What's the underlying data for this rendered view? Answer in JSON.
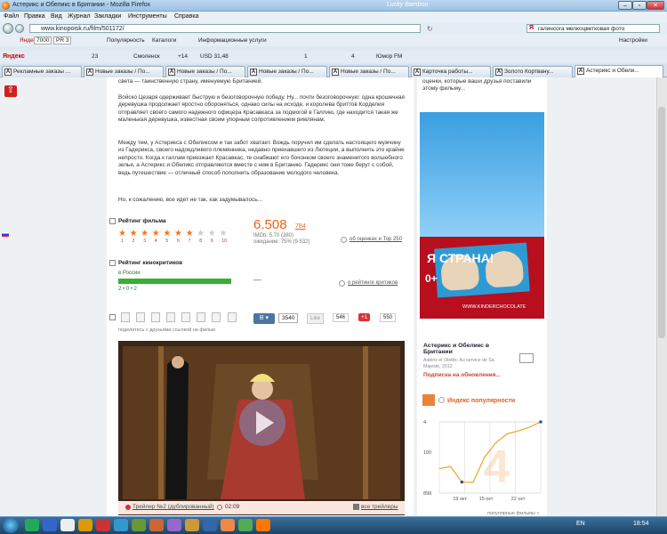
{
  "window": {
    "title": "Астерикс и Обеликс в Британии - Mozilla Firefox",
    "brand": "Lucky Bamboo"
  },
  "menu": [
    "Файл",
    "Правка",
    "Вид",
    "Журнал",
    "Закладки",
    "Инструменты",
    "Справка"
  ],
  "url": "www.kinopoisk.ru/film/501172/",
  "search_value": "галинсога мелкоцветковая фото",
  "toolbar1": {
    "ya": "Яндекс",
    "pr": "PR 3",
    "tic": "7000",
    "popular": "Популярность",
    "catalogs": "Каталоги",
    "info": "Информационные услуги"
  },
  "toolbar2": {
    "mail": "23",
    "weather": "Смоленск",
    "temp": "+14",
    "usd": "USD 31,48",
    "num1": "1",
    "num2": "4",
    "humor": "Юмор FM",
    "settings": "Настройки"
  },
  "tabs": [
    "Рекламные заказы ...",
    "Новые заказы / По...",
    "Новые заказы / По...",
    "Новые заказы / По...",
    "Новые заказы / По...",
    "Карточка работы...",
    "Золото Кортвану...",
    "Астерикс и Обели..."
  ],
  "text": {
    "p0": "света — таинственную страну, именуемую Британией.",
    "p1": "Войско Цезаря одерживает быструю и безоговорочную победу. Ну... почти безоговорочную: одна крошечная деревушка продолжает яростно обороняться, однако силы на исходе, и королева бриттов Корделия отправляет своего самого надежного офицера Красавкаса за подмогой в Галлию, где находится такая же маленькая деревушка, известная своим упорным сопротивлением римлянам.",
    "p2": "Между тем, у Астерикса с Обеликсом и так забот хватает. Вождь поручил им сделать настоящего мужчину из Гадерикса, своего надоедливого племянника, недавно приехавшего из Лютеции, а выполнить это крайне непросто. Когда к галлам приезжает Красавкас, те снабжают его бочонком своего знаменитого волшебного зелья, а Астерикс и Обеликс отправляются вместе с ним в Британию. Гадерикс они тоже берут с собой, ведь путешествие — отличный способ пополнить образование молодого человека.",
    "p3": "Но, к сожалению, все идет не так, как задумывалось…"
  },
  "rating": {
    "label": "Рейтинг фильма",
    "value": "6.508",
    "count": "784",
    "imdb": "IMDb: 5.70 (380)",
    "expect": "ожидание: 75% (9 532)",
    "link": "об оценках и Top 250",
    "scale": [
      "1",
      "2",
      "3",
      "4",
      "5",
      "6",
      "7",
      "8",
      "9",
      "10"
    ],
    "stars_filled": 6.5
  },
  "critics": {
    "label": "Рейтинг кинокритиков",
    "region": "в России",
    "counts": "2 • 0 • 2",
    "dash": "—",
    "link": "о рейтинге критиков"
  },
  "share": {
    "caption": "поделитесь с друзьями ссылкой на фильм",
    "vk": "3540",
    "like": "Like",
    "like_count": "546",
    "g": "+1",
    "g_count": "550"
  },
  "video": {
    "caption": "Трейлер №2 (дублированный)",
    "time": "02:09",
    "all": "все трейлеры"
  },
  "sidebar": {
    "top_text": "оценки, которые ваши друзья поставили этому фильму...",
    "ad_text": "Я СТРАНА!",
    "ad_plus": "0+",
    "ad_url": "WWW.KINDERCHOCOLATE",
    "film_title": "Астерикс и Обеликс в Британии",
    "film_sub": "Astérix et Obélix: Au service de Sa Majesté, 2012",
    "subscribe": "Подписка на обновления...",
    "pop_title": "Индекс популярности",
    "pop_big": "4",
    "more": "популярные фильмы »"
  },
  "chart_data": {
    "type": "line",
    "x": [
      "~17",
      "18",
      "19",
      "20",
      "21",
      "22",
      "23",
      "24",
      "25",
      "26"
    ],
    "values": [
      140,
      120,
      390,
      395,
      60,
      20,
      10,
      8,
      6,
      4
    ],
    "ylim": [
      898,
      4
    ],
    "ytick_labels": [
      "4",
      "100",
      "898"
    ],
    "xtick_labels": [
      "19 окт",
      "15 окт",
      "22 окт"
    ],
    "xlabel": "",
    "ylabel": ""
  },
  "taskbar": {
    "lang": "EN",
    "time": "18:54"
  }
}
